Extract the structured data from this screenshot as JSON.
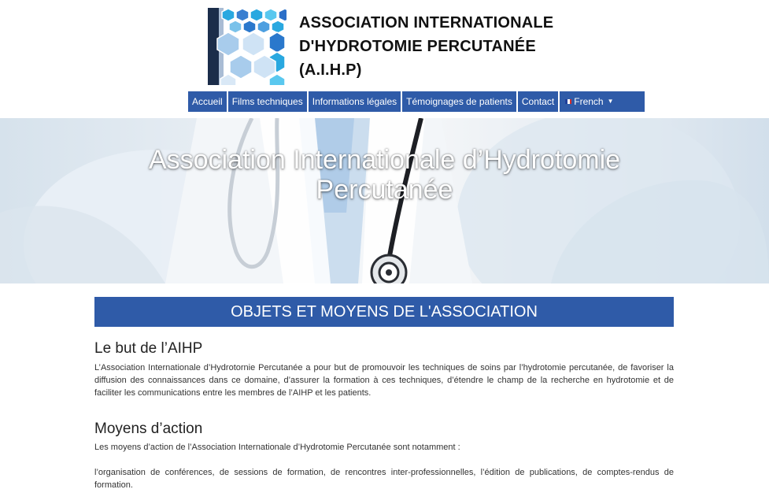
{
  "header": {
    "logo_name": "aihp-hexagon-logo",
    "title_lines": [
      "ASSOCIATION INTERNATIONALE",
      "D'HYDROTOMIE PERCUTANÉE",
      "(A.I.H.P)"
    ]
  },
  "nav": {
    "items": [
      "Accueil",
      "Films techniques",
      "Informations légales",
      "Témoignages de patients",
      "Contact"
    ],
    "language": "French"
  },
  "hero": {
    "title_line1": "Association Internationale d’Hydrotomie",
    "title_line2": "Percutanée"
  },
  "section": {
    "banner": "OBJETS ET MOYENS DE L'ASSOCIATION",
    "goal_heading": "Le but de l’AIHP",
    "goal_text": "L’Association Internationale d’Hydrotornie Percutanée a pour but de promouvoir les techniques de soins par l’hydrotomie percutanée, de favoriser la diffusion des connaissances dans ce domaine, d’assurer la formation à ces techniques, d’étendre le champ de la recherche en hydrotomie et de faciliter les communications entre les membres de l’AIHP et les patients.",
    "means_heading": "Moyens d’action",
    "means_intro": "Les moyens d’action de l’Association Internationale d’Hydrotomie Percutanée sont notamment :",
    "means_item": "l’organisation de conférences, de sessions de formation, de rencontres inter-professionnelles, l’édition de publications, de comptes-rendus de formation."
  },
  "colors": {
    "primary": "#2f5ba8",
    "text": "#212529"
  }
}
